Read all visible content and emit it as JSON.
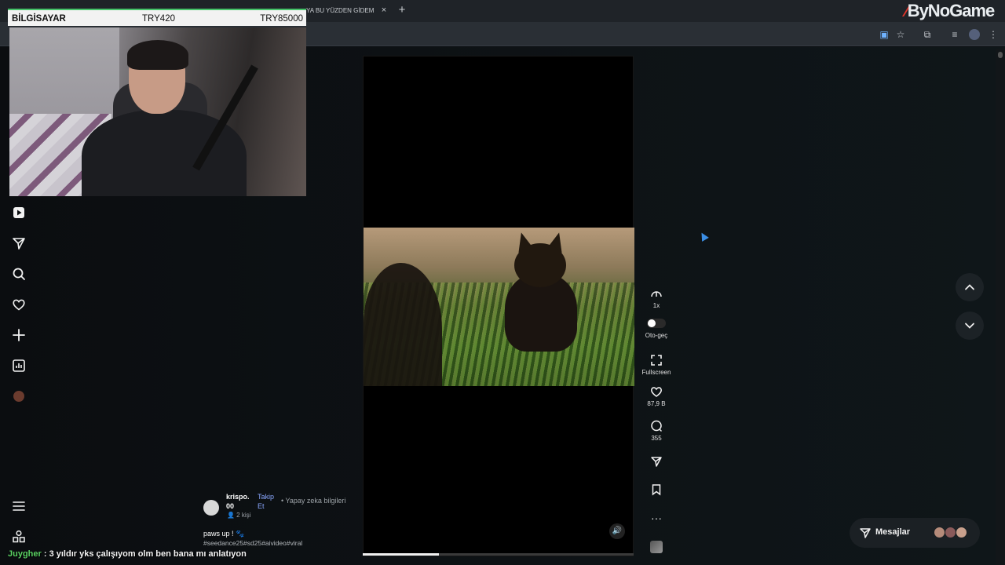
{
  "browser": {
    "tab_title": "YA BU YÜZDEN GİDEM",
    "tab_close": "×",
    "new_tab": "+",
    "brand_mark": "⁄",
    "brand_text": "ByNoGame"
  },
  "overlay": {
    "label": "BİLGİSAYAR",
    "current_bid": "TRY420",
    "target": "TRY85000"
  },
  "sidebar": {
    "items": [
      "play-icon",
      "send-icon",
      "search-icon",
      "heart-icon",
      "plus-icon",
      "stats-icon",
      "profile-avatar",
      "menu-icon",
      "apps-icon"
    ]
  },
  "video": {
    "progress_fraction": 0.28,
    "volume_icon": "🔊"
  },
  "creator": {
    "name": "krispo.\n00",
    "follow": "Takip Et",
    "ai_info": "• Yapay zeka bilgileri",
    "followers": "👤 2 kişi",
    "caption": "paws up ! 🐾",
    "tags": "#seedance25#sd25#aivideo#viral"
  },
  "actions": {
    "speed": "1x",
    "autoplay_label": "Oto-geç",
    "fullscreen_label": "Fullscreen",
    "likes": "87,9 B",
    "comments": "355",
    "more": "···"
  },
  "messages": {
    "label": "Mesajlar"
  },
  "chat": {
    "user": "Juygher",
    "message": " : 3 yıldır yks çalışıyom olm ben bana mı anlatıyon"
  },
  "colors": {
    "accent_blue": "#8aa8ff",
    "chat_user": "#5ad162",
    "overlay_bar": "#46c46a"
  }
}
